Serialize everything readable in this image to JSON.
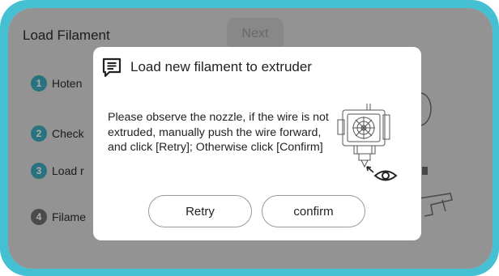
{
  "background": {
    "title": "Load Filament",
    "next_label": "Next",
    "steps": [
      {
        "num": "1",
        "label": "Hoten"
      },
      {
        "num": "2",
        "label": "Check"
      },
      {
        "num": "3",
        "label": "Load r"
      },
      {
        "num": "4",
        "label": "Filame"
      }
    ]
  },
  "dialog": {
    "title": "Load new filament to extruder",
    "message": "Please observe the nozzle, if the wire is not extruded, manually push the wire forward, and click [Retry]; Otherwise click [Confirm]",
    "retry_label": "Retry",
    "confirm_label": "confirm",
    "title_icon": "message-icon",
    "illustration_icon": "extruder-eye-icon"
  },
  "colors": {
    "frame": "#45bfd2",
    "step_active": "#3da9bd",
    "step_inactive": "#6f6f6f"
  }
}
